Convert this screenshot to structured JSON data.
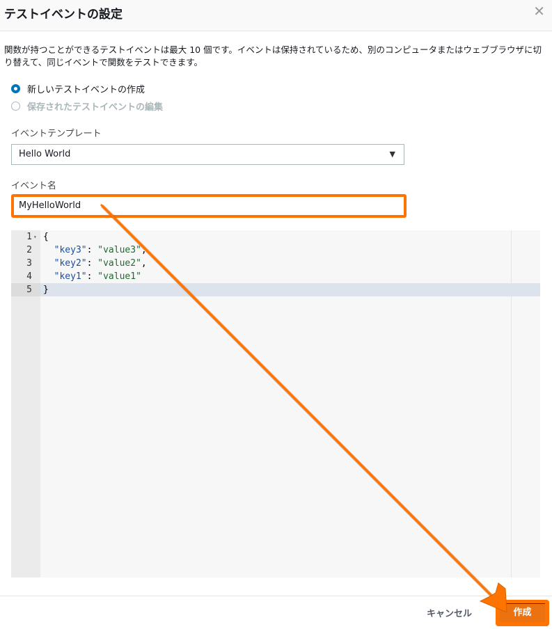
{
  "dialog": {
    "title": "テストイベントの設定",
    "close_icon": "close-icon",
    "description": "関数が持つことができるテストイベントは最大 10 個です。イベントは保持されているため、別のコンピュータまたはウェブブラウザに切り替えて、同じイベントで関数をテストできます。"
  },
  "options": [
    {
      "label": "新しいテストイベントの作成",
      "selected": true
    },
    {
      "label": "保存されたテストイベントの編集",
      "selected": false
    }
  ],
  "template": {
    "label": "イベントテンプレート",
    "value": "Hello World"
  },
  "event_name": {
    "label": "イベント名",
    "value": "MyHelloWorld"
  },
  "editor": {
    "lines": [
      {
        "n": "1",
        "code": "{"
      },
      {
        "n": "2",
        "key": "\"key3\"",
        "val": "\"value3\"",
        "end": ","
      },
      {
        "n": "3",
        "key": "\"key2\"",
        "val": "\"value2\"",
        "end": ","
      },
      {
        "n": "4",
        "key": "\"key1\"",
        "val": "\"value1\"",
        "end": ""
      },
      {
        "n": "5",
        "code": "}"
      }
    ]
  },
  "footer": {
    "cancel": "キャンセル",
    "create": "作成"
  },
  "colors": {
    "accent": "#ff7300",
    "primary": "#ec7211"
  }
}
